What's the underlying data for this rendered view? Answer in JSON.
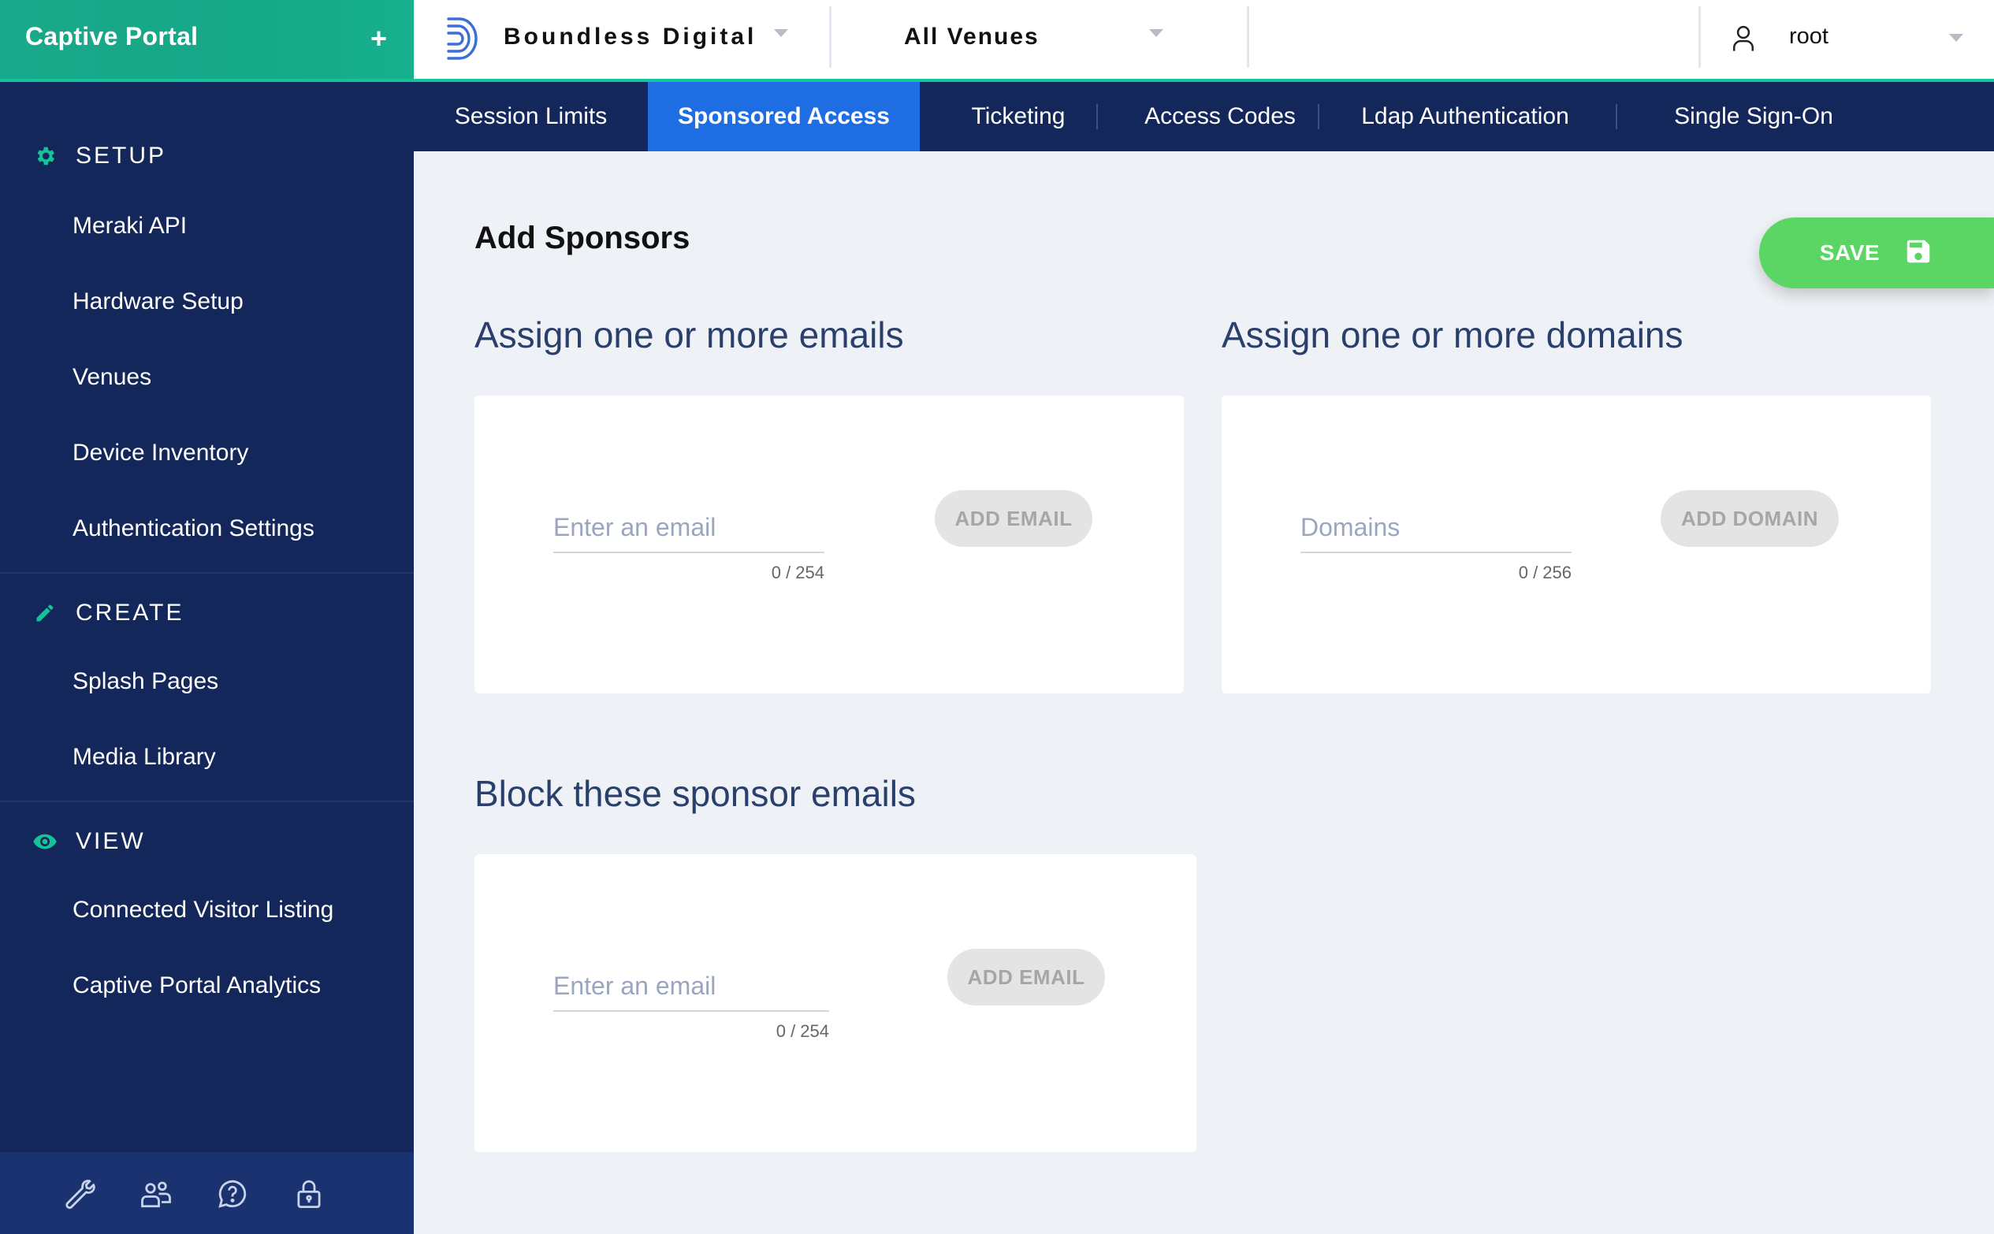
{
  "sidebar": {
    "app_title": "Captive Portal",
    "add_symbol": "+",
    "sections": [
      {
        "label": "SETUP",
        "icon": "gear-icon",
        "items": [
          "Meraki API",
          "Hardware Setup",
          "Venues",
          "Device Inventory",
          "Authentication Settings"
        ]
      },
      {
        "label": "CREATE",
        "icon": "pencil-icon",
        "items": [
          "Splash Pages",
          "Media Library"
        ]
      },
      {
        "label": "VIEW",
        "icon": "eye-icon",
        "items": [
          "Connected Visitor Listing",
          "Captive Portal Analytics"
        ]
      }
    ],
    "footer_icons": [
      "wrench-icon",
      "users-icon",
      "help-icon",
      "lock-icon"
    ]
  },
  "header": {
    "organization": "Boundless Digital",
    "venue": "All Venues",
    "user": "root"
  },
  "tabs": [
    {
      "label": "Session Limits",
      "active": false
    },
    {
      "label": "Sponsored Access",
      "active": true
    },
    {
      "label": "Ticketing",
      "active": false
    },
    {
      "label": "Access Codes",
      "active": false
    },
    {
      "label": "Ldap Authentication",
      "active": false
    },
    {
      "label": "Single Sign-On",
      "active": false
    }
  ],
  "main": {
    "page_title": "Add Sponsors",
    "save_label": "SAVE",
    "emails": {
      "heading": "Assign one or more emails",
      "placeholder": "Enter an email",
      "value": "",
      "counter": "0 / 254",
      "button": "ADD EMAIL"
    },
    "domains": {
      "heading": "Assign one or more domains",
      "placeholder": "Domains",
      "value": "",
      "counter": "0 / 256",
      "button": "ADD DOMAIN"
    },
    "blocked": {
      "heading": "Block these sponsor emails",
      "placeholder": "Enter an email",
      "value": "",
      "counter": "0 / 254",
      "button": "ADD EMAIL"
    }
  },
  "colors": {
    "sidebar_bg": "#14275a",
    "brand_green": "#15a887",
    "active_tab": "#1f6de3",
    "save_green": "#5bd664",
    "heading_text": "#2a3f6c"
  }
}
